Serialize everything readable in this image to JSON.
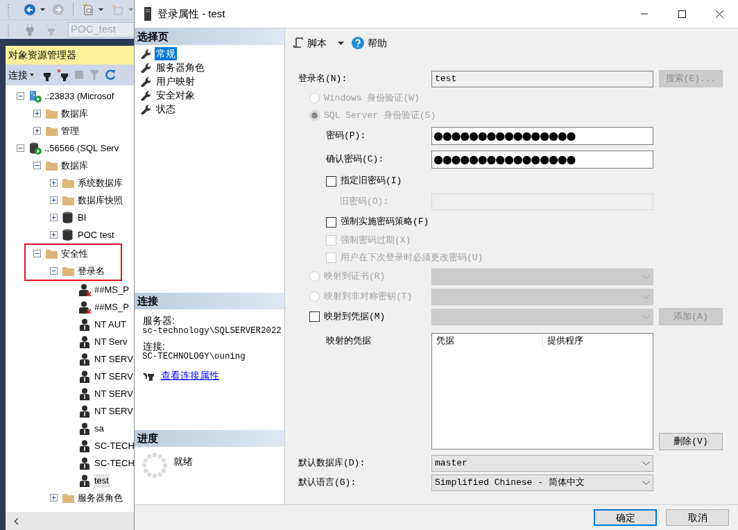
{
  "ssms": {
    "toolbar_dropdown": {
      "value": "POC_test",
      "disabled": true
    },
    "object_explorer": {
      "title": "对象资源管理器",
      "connect_button": "连接",
      "tree": [
        {
          "label": ".:23833 (Microsof",
          "kind": "server_cloud",
          "expanded": true,
          "selected": false,
          "highlighted": false,
          "children": [
            {
              "label": "数据库",
              "kind": "folder",
              "expanded": false,
              "selected": false,
              "highlighted": false
            },
            {
              "label": "管理",
              "kind": "folder",
              "expanded": false,
              "selected": false,
              "highlighted": false
            }
          ]
        },
        {
          "label": ".,56566 (SQL Serv",
          "kind": "server",
          "expanded": true,
          "selected": false,
          "highlighted": false,
          "children": [
            {
              "label": "数据库",
              "kind": "folder",
              "expanded": true,
              "selected": false,
              "highlighted": false,
              "children": [
                {
                  "label": "系统数据库",
                  "kind": "folder",
                  "expanded": false,
                  "selected": false,
                  "highlighted": false
                },
                {
                  "label": "数据库快照",
                  "kind": "folder",
                  "expanded": false,
                  "selected": false,
                  "highlighted": false
                },
                {
                  "label": "BI",
                  "kind": "database",
                  "expanded": false,
                  "selected": false,
                  "highlighted": false
                },
                {
                  "label": "POC test",
                  "kind": "database",
                  "expanded": false,
                  "selected": false,
                  "highlighted": false
                }
              ]
            },
            {
              "label": "安全性",
              "kind": "folder",
              "expanded": true,
              "selected": false,
              "highlighted": true,
              "children": [
                {
                  "label": "登录名",
                  "kind": "folder",
                  "expanded": true,
                  "selected": false,
                  "highlighted": true,
                  "children": [
                    {
                      "label": "##MS_P",
                      "kind": "login_disabled",
                      "selected": false,
                      "highlighted": false
                    },
                    {
                      "label": "##MS_P",
                      "kind": "login_disabled",
                      "selected": false,
                      "highlighted": false
                    },
                    {
                      "label": "NT AUT",
                      "kind": "login",
                      "selected": false,
                      "highlighted": false
                    },
                    {
                      "label": "NT Serv",
                      "kind": "login",
                      "selected": false,
                      "highlighted": false
                    },
                    {
                      "label": "NT SERV",
                      "kind": "login",
                      "selected": false,
                      "highlighted": false
                    },
                    {
                      "label": "NT SERV",
                      "kind": "login",
                      "selected": false,
                      "highlighted": false
                    },
                    {
                      "label": "NT SERV",
                      "kind": "login",
                      "selected": false,
                      "highlighted": false
                    },
                    {
                      "label": "NT SERV",
                      "kind": "login",
                      "selected": false,
                      "highlighted": false
                    },
                    {
                      "label": "sa",
                      "kind": "login",
                      "selected": false,
                      "highlighted": false
                    },
                    {
                      "label": "SC-TECH",
                      "kind": "login",
                      "selected": false,
                      "highlighted": false
                    },
                    {
                      "label": "SC-TECH",
                      "kind": "login",
                      "selected": false,
                      "highlighted": false
                    },
                    {
                      "label": "test",
                      "kind": "login",
                      "selected": true,
                      "highlighted": false
                    }
                  ]
                },
                {
                  "label": "服务器角色",
                  "kind": "folder",
                  "expanded": false,
                  "selected": false,
                  "highlighted": false
                }
              ]
            }
          ]
        }
      ]
    }
  },
  "dialog": {
    "title": "登录属性 - test",
    "select_page": {
      "header": "选择页",
      "items": [
        {
          "label": "常规",
          "selected": true
        },
        {
          "label": "服务器角色",
          "selected": false
        },
        {
          "label": "用户映射",
          "selected": false
        },
        {
          "label": "安全对象",
          "selected": false
        },
        {
          "label": "状态",
          "selected": false
        }
      ]
    },
    "connection": {
      "header": "连接",
      "server_label": "服务器:",
      "server": "sc-technology\\SQLSERVER2022",
      "connection_label": "连接:",
      "connection": "SC-TECHNOLOGY\\ouning",
      "link": "查看连接属性"
    },
    "progress": {
      "header": "进度",
      "status": "就绪"
    },
    "toolbar": {
      "script": "脚本",
      "help": "帮助"
    },
    "form": [
      {
        "kind": "field",
        "label": "登录名(N):",
        "value": "test",
        "readonly": true,
        "disabled": false,
        "button": {
          "label": "搜索(E)...",
          "disabled": true
        }
      },
      {
        "kind": "radio",
        "label": "Windows 身份验证(W)",
        "selected": false,
        "disabled": true
      },
      {
        "kind": "radio",
        "label": "SQL Server 身份验证(S)",
        "selected": true,
        "disabled": true,
        "children": [
          {
            "kind": "password",
            "label": "密码(P):",
            "value": "●●●●●●●●●●●●●●●●"
          },
          {
            "kind": "password",
            "label": "确认密码(C):",
            "value": "●●●●●●●●●●●●●●●●"
          },
          {
            "kind": "checkbox",
            "label": "指定旧密码(I)",
            "checked": false,
            "disabled": false,
            "children": [
              {
                "kind": "field",
                "label": "旧密码(O):",
                "disabled": true
              }
            ]
          },
          {
            "kind": "checkbox",
            "label": "强制实施密码策略(F)",
            "checked": false,
            "disabled": false
          },
          {
            "kind": "checkbox",
            "label": "强制密码过期(X)",
            "checked": false,
            "disabled": true
          },
          {
            "kind": "checkbox",
            "label": "用户在下次登录时必须更改密码(U)",
            "checked": false,
            "disabled": true
          }
        ]
      },
      {
        "kind": "radio",
        "label": "映射到证书(R)",
        "selected": false,
        "disabled": true,
        "dropdown": {
          "disabled": true
        }
      },
      {
        "kind": "radio",
        "label": "映射到非对称密钥(T)",
        "selected": false,
        "disabled": true,
        "dropdown": {
          "disabled": true
        }
      },
      {
        "kind": "checkbox",
        "label": "映射到凭据(M)",
        "checked": false,
        "disabled": false,
        "dropdown": {
          "disabled": true
        },
        "button": {
          "label": "添加(A)",
          "disabled": true
        },
        "children": [
          {
            "kind": "list",
            "label": "映射的凭据",
            "columns": [
              "凭据",
              "提供程序"
            ],
            "button": {
              "label": "删除(V)",
              "disabled": false
            }
          }
        ]
      },
      {
        "kind": "dropdown",
        "label": "默认数据库(D):",
        "value": "master",
        "disabled": false
      },
      {
        "kind": "dropdown",
        "label": "默认语言(G):",
        "value": "Simplified Chinese - 简体中文",
        "disabled": false
      }
    ],
    "footer_buttons": [
      {
        "label": "确定",
        "default": true
      },
      {
        "label": "取消",
        "default": false
      }
    ]
  }
}
